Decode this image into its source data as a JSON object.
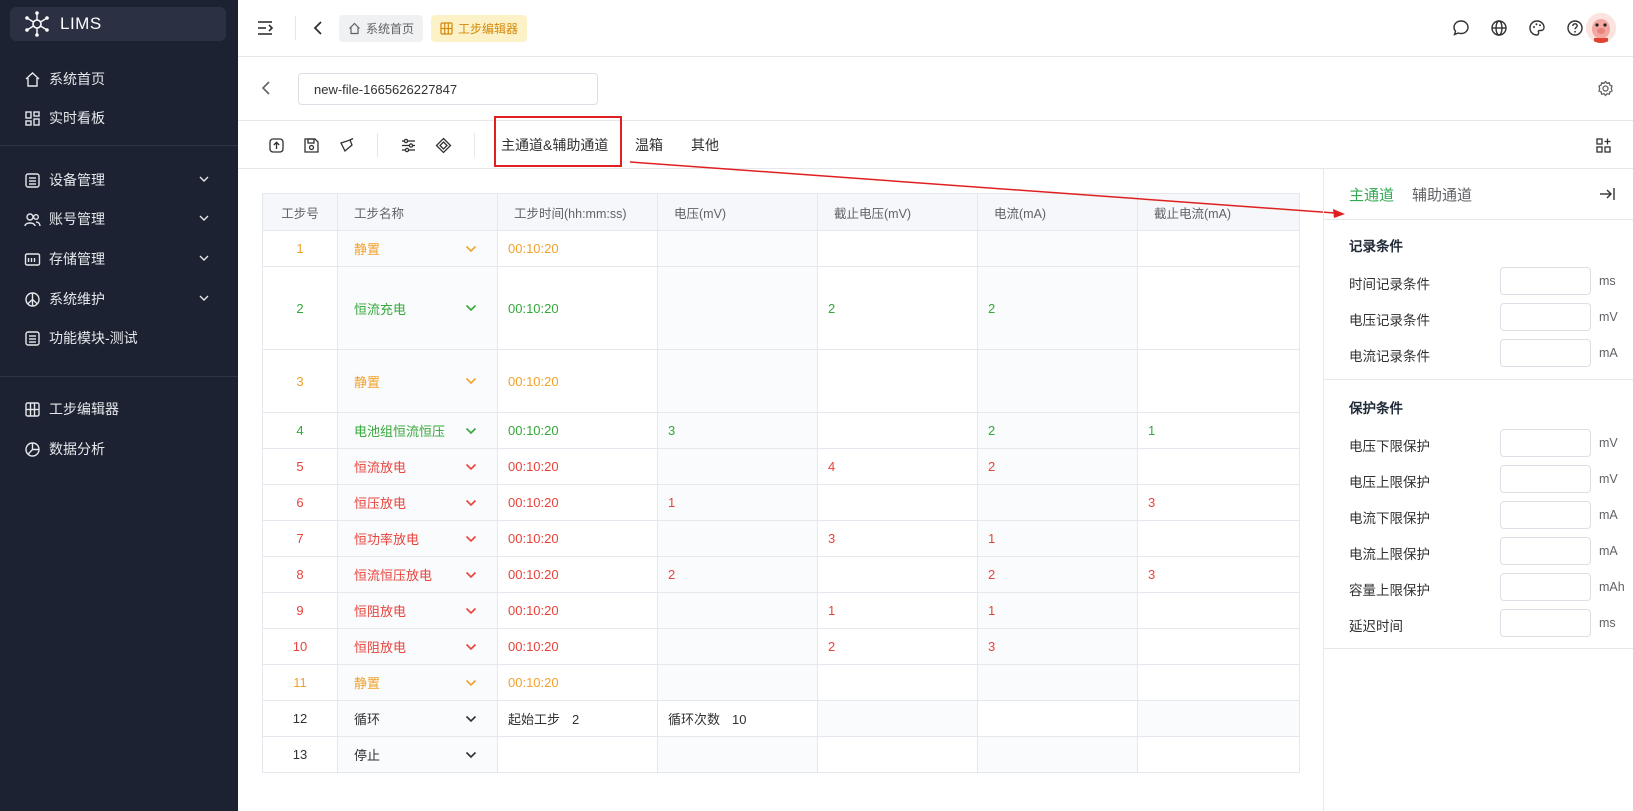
{
  "app": {
    "name": "LIMS"
  },
  "sidebar": {
    "items": [
      {
        "label": "系统首页",
        "icon": "home-icon"
      },
      {
        "label": "实时看板",
        "icon": "dashboard-icon"
      },
      {
        "label": "设备管理",
        "icon": "device-icon",
        "expandable": true
      },
      {
        "label": "账号管理",
        "icon": "users-icon",
        "expandable": true
      },
      {
        "label": "存储管理",
        "icon": "storage-icon",
        "expandable": true
      },
      {
        "label": "系统维护",
        "icon": "maintenance-icon",
        "expandable": true
      },
      {
        "label": "功能模块-测试",
        "icon": "module-icon"
      },
      {
        "label": "工步编辑器",
        "icon": "grid-icon"
      },
      {
        "label": "数据分析",
        "icon": "pie-chart-icon"
      }
    ]
  },
  "header": {
    "breadcrumbs": [
      {
        "label": "系统首页"
      },
      {
        "label": "工步编辑器"
      }
    ]
  },
  "file": {
    "name": "new-file-1665626227847"
  },
  "toolbar": {
    "tabs": [
      "主通道&辅助通道",
      "温箱",
      "其他"
    ]
  },
  "table": {
    "headers": [
      "工步号",
      "工步名称",
      "工步时间(hh:mm:ss)",
      "电压(mV)",
      "截止电压(mV)",
      "电流(mA)",
      "截止电流(mA)"
    ],
    "rows": [
      {
        "no": "1",
        "name": "静置",
        "time": "00:10:20",
        "v": "",
        "cv": "",
        "i": "",
        "ci": "",
        "color": "orange"
      },
      {
        "no": "2",
        "name": "恒流充电",
        "time": "00:10:20",
        "v": "",
        "cv": "2",
        "i": "2",
        "ci": "",
        "color": "green"
      },
      {
        "no": "3",
        "name": "静置",
        "time": "00:10:20",
        "v": "",
        "cv": "",
        "i": "",
        "ci": "",
        "color": "orange"
      },
      {
        "no": "4",
        "name": "电池组恒流恒压",
        "time": "00:10:20",
        "v": "3",
        "cv": "",
        "i": "2",
        "ci": "1",
        "color": "green"
      },
      {
        "no": "5",
        "name": "恒流放电",
        "time": "00:10:20",
        "v": "",
        "cv": "4",
        "i": "2",
        "ci": "",
        "color": "red"
      },
      {
        "no": "6",
        "name": "恒压放电",
        "time": "00:10:20",
        "v": "1",
        "cv": "",
        "i": "",
        "ci": "3",
        "color": "red"
      },
      {
        "no": "7",
        "name": "恒功率放电",
        "time": "00:10:20",
        "v": "",
        "cv": "3",
        "i": "1",
        "ci": "",
        "color": "red"
      },
      {
        "no": "8",
        "name": "恒流恒压放电",
        "time": "00:10:20",
        "v": "2",
        "cv": "",
        "i": "2",
        "ci": "3",
        "color": "red"
      },
      {
        "no": "9",
        "name": "恒阻放电",
        "time": "00:10:20",
        "v": "",
        "cv": "1",
        "i": "1",
        "ci": "",
        "color": "red"
      },
      {
        "no": "10",
        "name": "恒阻放电",
        "time": "00:10:20",
        "v": "",
        "cv": "2",
        "i": "3",
        "ci": "",
        "color": "red"
      },
      {
        "no": "11",
        "name": "静置",
        "time": "00:10:20",
        "v": "",
        "cv": "",
        "i": "",
        "ci": "",
        "color": "orange"
      },
      {
        "no": "12",
        "name": "循环",
        "loop": {
          "start_label": "起始工步",
          "start_value": "2",
          "count_label": "循环次数",
          "count_value": "10"
        },
        "color": "dark"
      },
      {
        "no": "13",
        "name": "停止",
        "time": "",
        "v": "",
        "cv": "",
        "i": "",
        "ci": "",
        "color": "dark"
      }
    ]
  },
  "panel": {
    "tabs": [
      "主通道",
      "辅助通道"
    ],
    "record": {
      "title": "记录条件",
      "rows": [
        {
          "label": "时间记录条件",
          "unit": "ms"
        },
        {
          "label": "电压记录条件",
          "unit": "mV"
        },
        {
          "label": "电流记录条件",
          "unit": "mA"
        }
      ]
    },
    "protect": {
      "title": "保护条件",
      "rows": [
        {
          "label": "电压下限保护",
          "unit": "mV"
        },
        {
          "label": "电压上限保护",
          "unit": "mV"
        },
        {
          "label": "电流下限保护",
          "unit": "mA"
        },
        {
          "label": "电流上限保护",
          "unit": "mA"
        },
        {
          "label": "容量上限保护",
          "unit": "mAh"
        },
        {
          "label": "延迟时间",
          "unit": "ms"
        }
      ]
    }
  },
  "colors": {
    "orange": "#f2a12a",
    "green": "#34a83a",
    "red": "#e8433b",
    "dark": "#303133",
    "accent": "#34a853",
    "sidebar_bg": "#1c2231",
    "highlight": "#e02020"
  }
}
